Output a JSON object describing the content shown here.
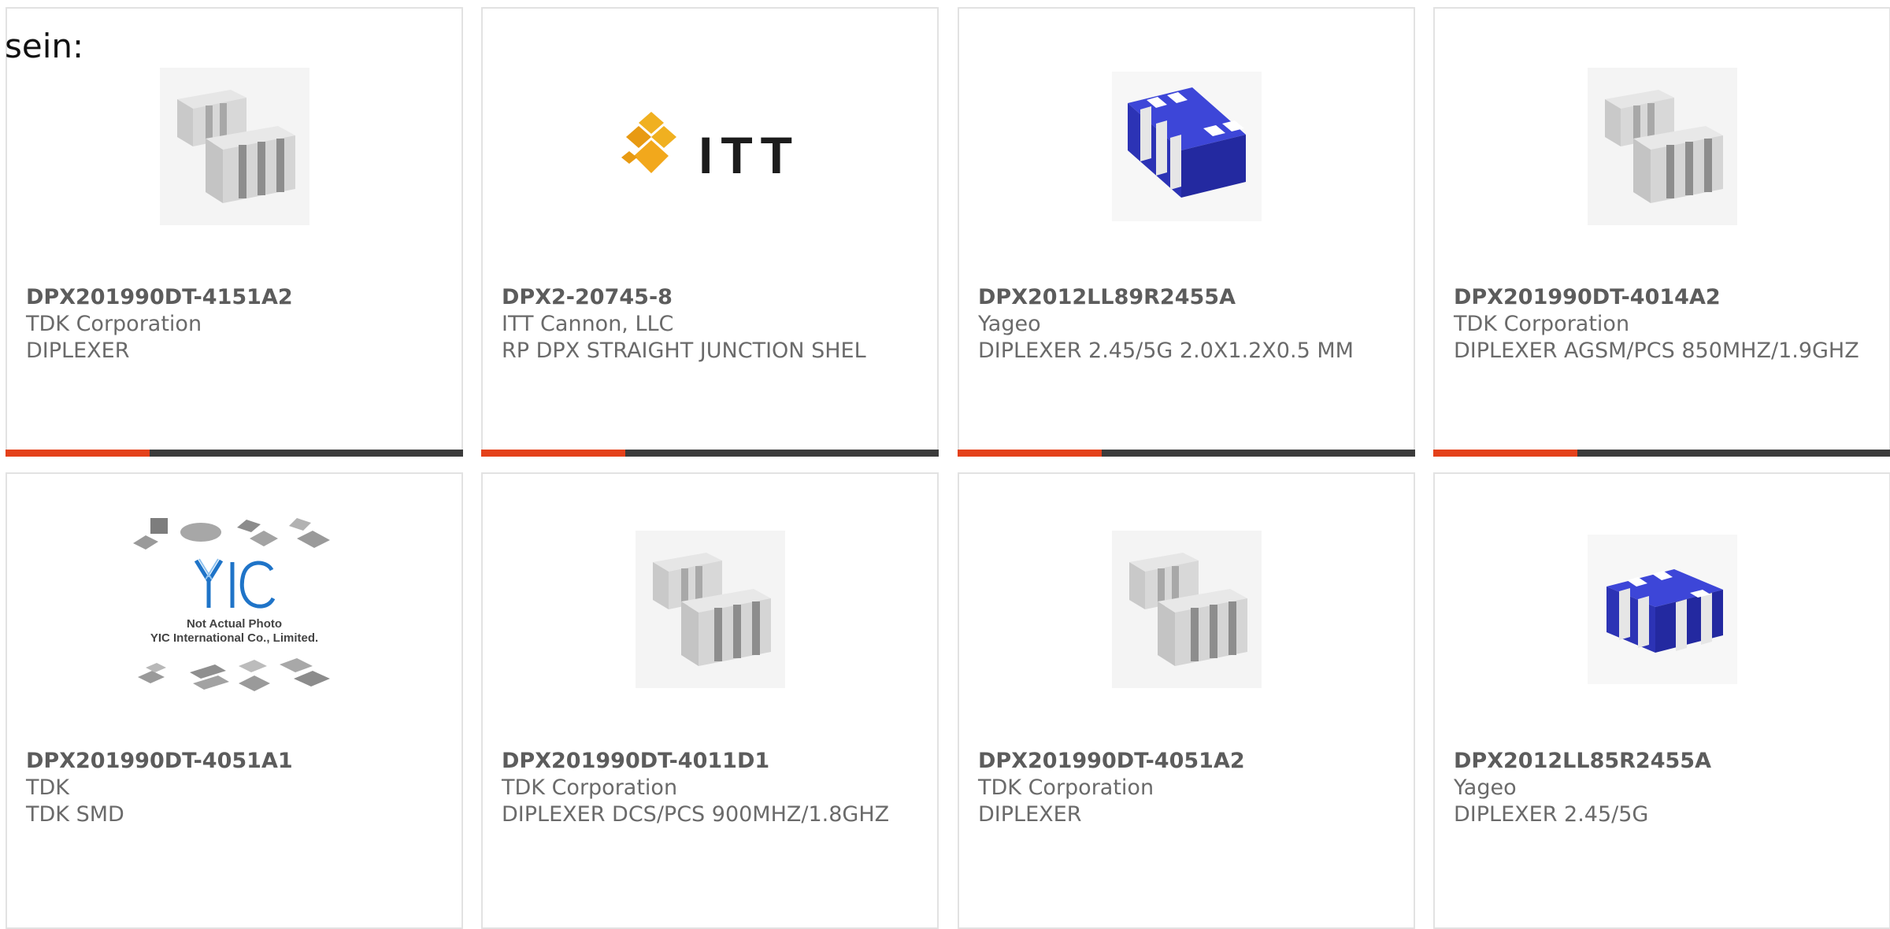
{
  "intro_text": "sein:",
  "accent_color": "#e4411a",
  "bar_color": "#3b3b3b",
  "products": [
    {
      "part_number": "DPX201990DT-4151A2",
      "manufacturer": "TDK Corporation",
      "description": "DIPLEXER",
      "image": "tdk-chip-pair"
    },
    {
      "part_number": "DPX2-20745-8",
      "manufacturer": "ITT Cannon, LLC",
      "description": "RP DPX STRAIGHT JUNCTION SHEL",
      "image": "itt-logo",
      "logo_text": "ITT"
    },
    {
      "part_number": "DPX2012LL89R2455A",
      "manufacturer": "Yageo",
      "description": "DIPLEXER 2.45/5G 2.0X1.2X0.5 MM",
      "image": "blue-chip"
    },
    {
      "part_number": "DPX201990DT-4014A2",
      "manufacturer": "TDK Corporation",
      "description": "DIPLEXER AGSM/PCS 850MHZ/1.9GHZ",
      "image": "tdk-chip-pair"
    },
    {
      "part_number": "DPX201990DT-4051A1",
      "manufacturer": "TDK",
      "description": "TDK SMD",
      "image": "yic-placeholder",
      "placeholder_line1": "Not Actual Photo",
      "placeholder_line2": "YIC International Co., Limited."
    },
    {
      "part_number": "DPX201990DT-4011D1",
      "manufacturer": "TDK Corporation",
      "description": "DIPLEXER DCS/PCS 900MHZ/1.8GHZ",
      "image": "tdk-chip-pair"
    },
    {
      "part_number": "DPX201990DT-4051A2",
      "manufacturer": "TDK Corporation",
      "description": "DIPLEXER",
      "image": "tdk-chip-pair"
    },
    {
      "part_number": "DPX2012LL85R2455A",
      "manufacturer": "Yageo",
      "description": "DIPLEXER 2.45/5G",
      "image": "blue-chip"
    }
  ]
}
